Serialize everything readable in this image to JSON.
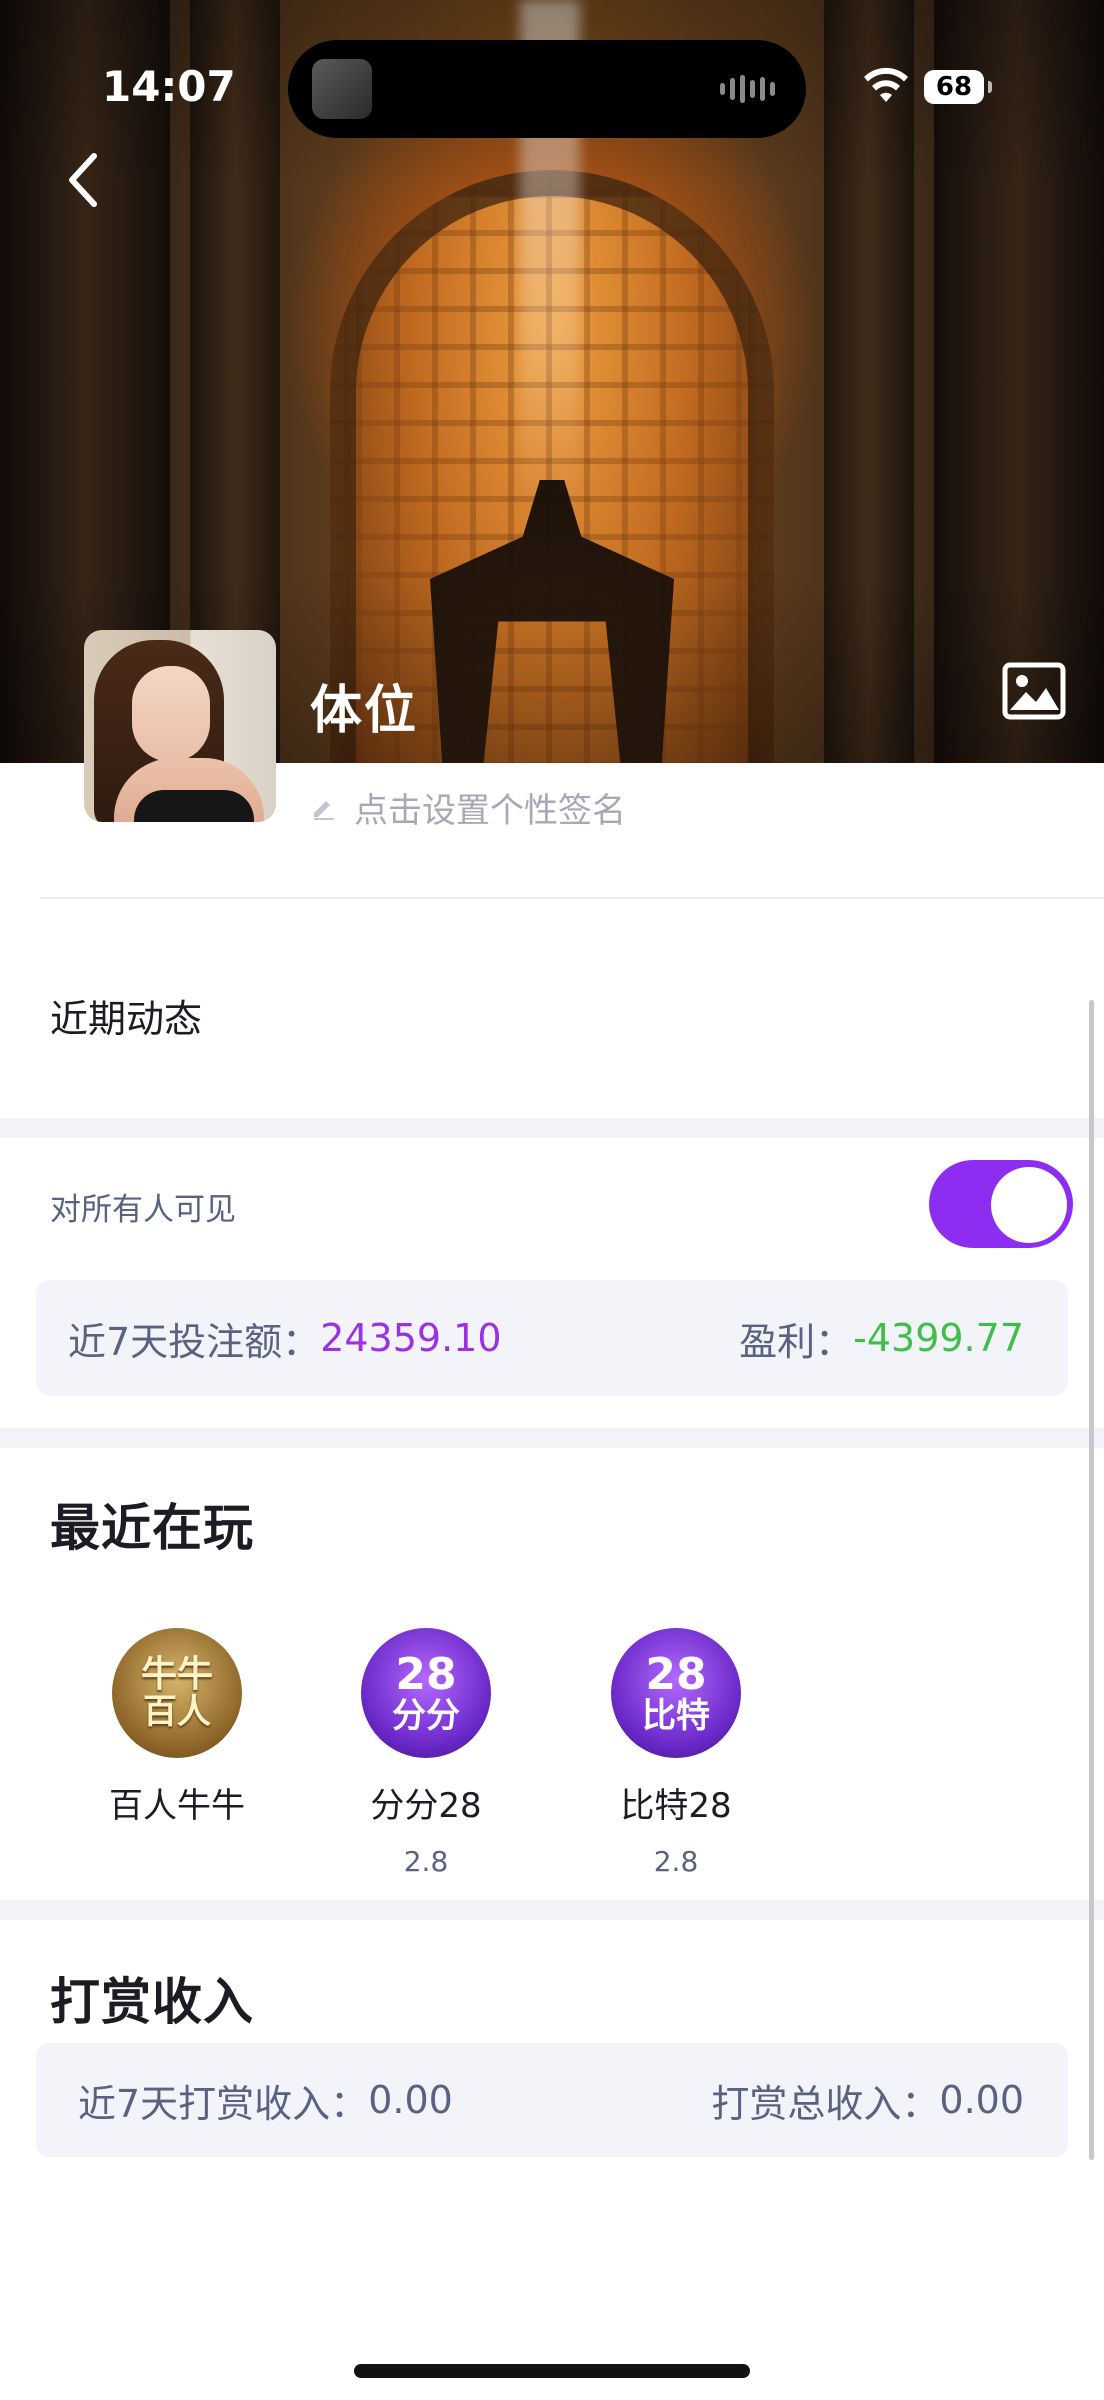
{
  "status_bar": {
    "time": "14:07",
    "battery": "68"
  },
  "profile": {
    "username": "体位",
    "signature_placeholder": "点击设置个性签名",
    "recent_activity_label": "近期动态"
  },
  "stats": {
    "visibility_label": "对所有人可见",
    "visibility_on": true,
    "bet_label": "近7天投注额：",
    "bet_value": "24359.10",
    "profit_label": "盈利：",
    "profit_value": "-4399.77"
  },
  "recent_games": {
    "title": "最近在玩",
    "items": [
      {
        "name": "百人牛牛",
        "odds": "",
        "icon": "niuniu-icon",
        "icon_text_1": "牛牛",
        "icon_text_2": "百人"
      },
      {
        "name": "分分28",
        "odds": "2.8",
        "icon": "fenfen28-icon",
        "icon_text_1": "28",
        "icon_text_2": "分分"
      },
      {
        "name": "比特28",
        "odds": "2.8",
        "icon": "bite28-icon",
        "icon_text_1": "28",
        "icon_text_2": "比特"
      }
    ]
  },
  "tips": {
    "title": "打赏收入",
    "week_label": "近7天打赏收入：",
    "week_value": "0.00",
    "total_label": "打赏总收入：",
    "total_value": "0.00"
  },
  "colors": {
    "accent_purple": "#8d2df2",
    "bet_value": "#9b30e6",
    "profit_value": "#3fbf4a",
    "card_bg": "#f3f4f9",
    "muted_text": "#5a6282"
  }
}
